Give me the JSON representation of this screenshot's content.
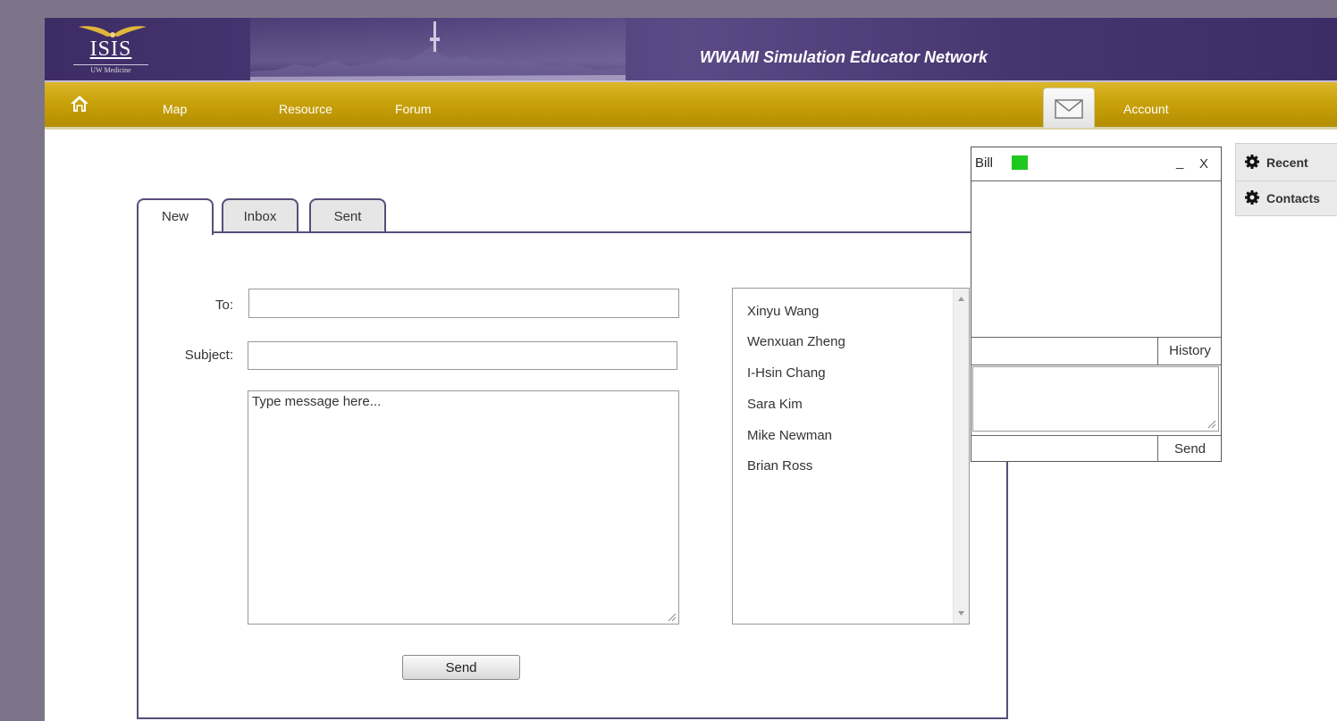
{
  "header": {
    "logo_text": "ISIS",
    "logo_sub": "UW Medicine",
    "site_title": "WWAMI Simulation Educator Network"
  },
  "nav": {
    "home_icon": "home-icon",
    "items": [
      {
        "label": "Map"
      },
      {
        "label": "Resource"
      },
      {
        "label": "Forum"
      }
    ],
    "mail_icon": "envelope-icon",
    "account_label": "Account"
  },
  "tabs": [
    {
      "label": "New",
      "active": true
    },
    {
      "label": "Inbox",
      "active": false
    },
    {
      "label": "Sent",
      "active": false
    }
  ],
  "compose": {
    "to_label": "To:",
    "to_value": "",
    "subject_label": "Subject:",
    "subject_value": "",
    "message_placeholder": "Type message here...",
    "send_label": "Send"
  },
  "contacts": [
    "Xinyu Wang",
    "Wenxuan Zheng",
    "I-Hsin Chang",
    "Sara Kim",
    "Mike Newman",
    "Brian Ross"
  ],
  "chat": {
    "name": "Bill",
    "status_color": "#1ec81e",
    "minimize_label": "_",
    "close_label": "X",
    "history_label": "History",
    "send_label": "Send"
  },
  "side_panel": {
    "items": [
      {
        "label": "Recent",
        "icon": "gear-icon"
      },
      {
        "label": "Contacts",
        "icon": "gear-icon"
      }
    ]
  },
  "colors": {
    "header_purple": "#3e2c66",
    "nav_gold": "#c9a20a",
    "tab_border": "#5a4d7a"
  }
}
